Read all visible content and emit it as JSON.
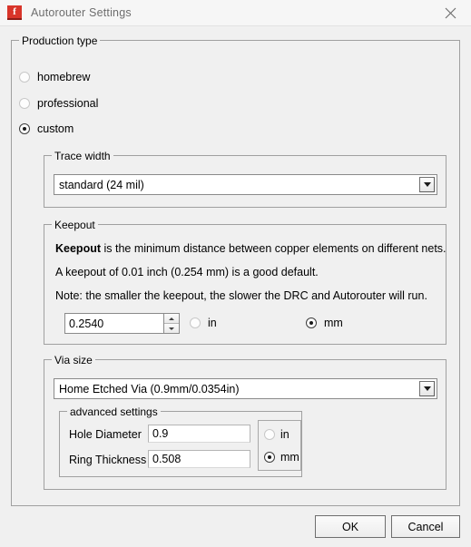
{
  "window": {
    "title": "Autorouter Settings",
    "icon": "fritzing-f-icon",
    "icon_letter": "f",
    "close_icon": "close-icon",
    "accent_color": "#d8352a",
    "background": "#f0f0f0"
  },
  "production_type": {
    "legend": "Production type",
    "options": [
      {
        "label": "homebrew",
        "selected": false
      },
      {
        "label": "professional",
        "selected": false
      },
      {
        "label": "custom",
        "selected": true
      }
    ]
  },
  "trace_width": {
    "legend": "Trace width",
    "selected": "standard (24 mil)"
  },
  "keepout": {
    "legend": "Keepout",
    "line1_bold": "Keepout",
    "line1_rest": " is the minimum distance between copper elements on different nets.",
    "line2": "A keepout of 0.01 inch (0.254 mm) is a good default.",
    "line3": "Note: the smaller the keepout, the slower the DRC and Autorouter will run.",
    "value": "0.2540",
    "units": [
      {
        "label": "in",
        "selected": false
      },
      {
        "label": "mm",
        "selected": true
      }
    ]
  },
  "via_size": {
    "legend": "Via size",
    "selected": "Home Etched Via (0.9mm/0.0354in)",
    "advanced": {
      "legend": "advanced settings",
      "hole_diameter_label": "Hole Diameter",
      "hole_diameter_value": "0.9",
      "ring_thickness_label": "Ring Thickness",
      "ring_thickness_value": "0.508",
      "units": [
        {
          "label": "in",
          "selected": false
        },
        {
          "label": "mm",
          "selected": true
        }
      ]
    }
  },
  "buttons": {
    "ok": "OK",
    "cancel": "Cancel"
  }
}
